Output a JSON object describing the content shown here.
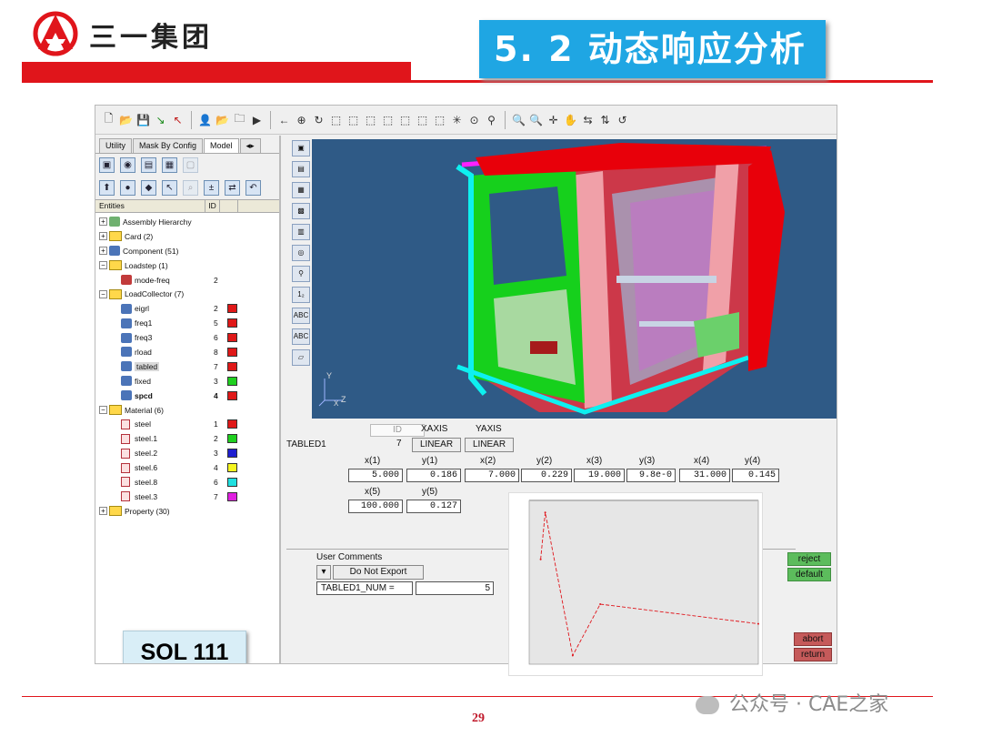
{
  "header": {
    "company": "三一集团",
    "slide_title": "5. 2 动态响应分析",
    "brand_red": "#e0151b",
    "title_bg": "#1fa6e3"
  },
  "panel": {
    "tabs": [
      "Utility",
      "Mask By Config",
      "Model"
    ],
    "columns": {
      "entities": "Entities",
      "id": "ID"
    },
    "tree": [
      {
        "label": "Assembly Hierarchy",
        "id": "",
        "color": ""
      },
      {
        "label": "Card (2)",
        "id": "",
        "color": ""
      },
      {
        "label": "Component (51)",
        "id": "",
        "color": ""
      },
      {
        "label": "Loadstep (1)",
        "id": "",
        "color": ""
      },
      {
        "label": "mode-freq",
        "id": "2",
        "color": ""
      },
      {
        "label": "LoadCollector (7)",
        "id": "",
        "color": ""
      },
      {
        "label": "eigrl",
        "id": "2",
        "color": "#e01818"
      },
      {
        "label": "freq1",
        "id": "5",
        "color": "#e01818"
      },
      {
        "label": "freq3",
        "id": "6",
        "color": "#e01818"
      },
      {
        "label": "rload",
        "id": "8",
        "color": "#e01818"
      },
      {
        "label": "tabled",
        "id": "7",
        "color": "#e01818"
      },
      {
        "label": "fixed",
        "id": "3",
        "color": "#1fd01f"
      },
      {
        "label": "spcd",
        "id": "4",
        "color": "#e01818"
      },
      {
        "label": "Material (6)",
        "id": "",
        "color": ""
      },
      {
        "label": "steel",
        "id": "1",
        "color": "#e01818"
      },
      {
        "label": "steel.1",
        "id": "2",
        "color": "#1fd01f"
      },
      {
        "label": "steel.2",
        "id": "3",
        "color": "#1f1fd0"
      },
      {
        "label": "steel.6",
        "id": "4",
        "color": "#f5f51f"
      },
      {
        "label": "steel.8",
        "id": "6",
        "color": "#1fe0e0"
      },
      {
        "label": "steel.3",
        "id": "7",
        "color": "#e01fe0"
      },
      {
        "label": "Property (30)",
        "id": "",
        "color": ""
      }
    ]
  },
  "sol_label": "SOL 111",
  "form": {
    "id_header": "ID",
    "xaxis_header": "XAXIS",
    "yaxis_header": "YAXIS",
    "card_name": "TABLED1",
    "card_id": "7",
    "xaxis_value": "LINEAR",
    "yaxis_value": "LINEAR",
    "col_labels": [
      "x(1)",
      "y(1)",
      "x(2)",
      "y(2)",
      "x(3)",
      "y(3)",
      "x(4)",
      "y(4)"
    ],
    "col_values": [
      "5.000",
      "0.186",
      "7.000",
      "0.229",
      "19.000",
      "9.8e-0",
      "31.000",
      "0.145"
    ],
    "row2_labels": [
      "x(5)",
      "y(5)"
    ],
    "row2_values": [
      "100.000",
      "0.127"
    ],
    "user_comments": "User Comments",
    "export_option": "Do Not Export",
    "num_label": "TABLED1_NUM =",
    "num_value": "5",
    "reject": "reject",
    "default": "default",
    "abort": "abort",
    "return": "return"
  },
  "chart_data": {
    "type": "line",
    "x": [
      5,
      7,
      19,
      31,
      100
    ],
    "y": [
      0.186,
      0.229,
      0.098,
      0.145,
      0.127
    ],
    "xlim": [
      0,
      100
    ],
    "series_color": "#e0151b"
  },
  "footer": {
    "page_number": "29",
    "watermark": "公众号 · CAE之家"
  }
}
